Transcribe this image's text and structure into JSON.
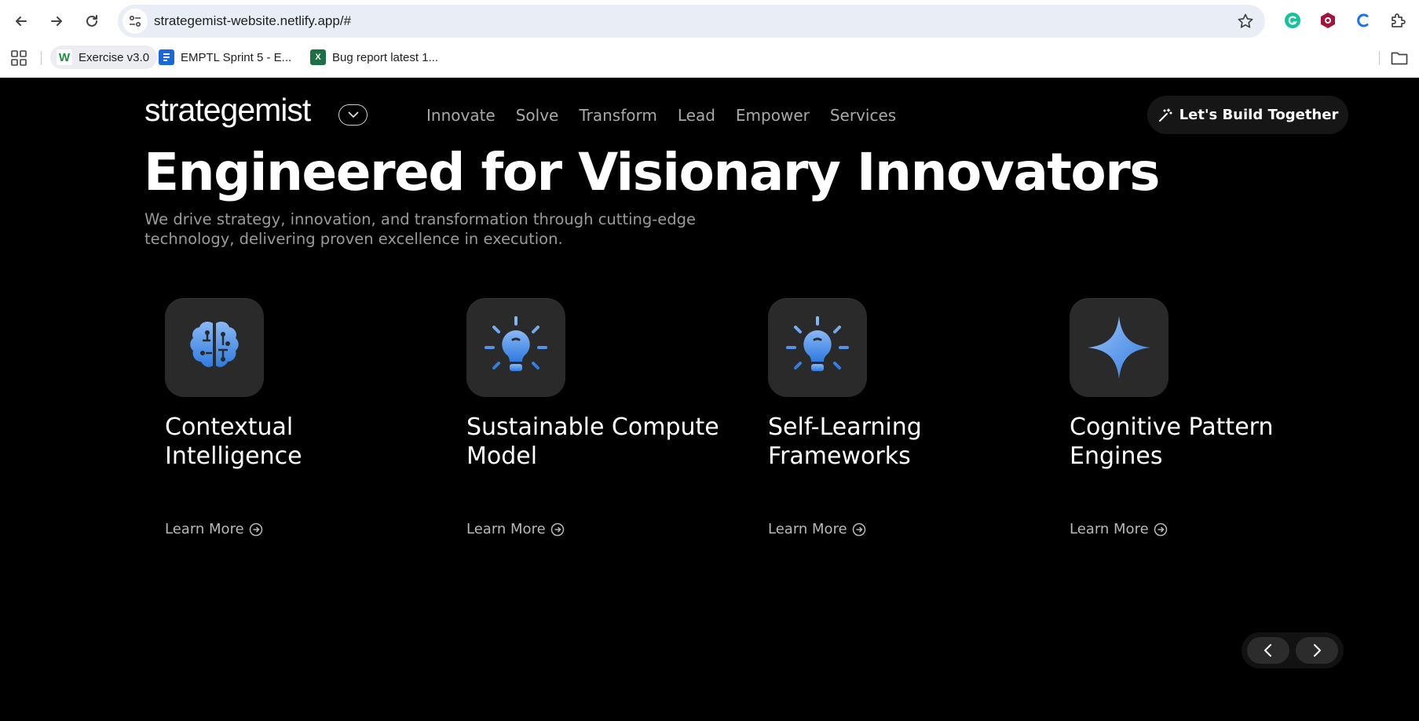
{
  "browser": {
    "url": "strategemist-website.netlify.app/#",
    "bookmarks": [
      {
        "label": "Exercise v3.0",
        "icon": "w-icon"
      },
      {
        "label": "EMPTL Sprint 5 - E...",
        "icon": "jira-icon"
      },
      {
        "label": "Bug report latest 1...",
        "icon": "excel-icon"
      }
    ]
  },
  "site": {
    "logo": "strategemist",
    "nav": [
      "Innovate",
      "Solve",
      "Transform",
      "Lead",
      "Empower",
      "Services"
    ],
    "cta_label": "Let's Build Together",
    "hero": {
      "title": "Engineered for Visionary Innovators",
      "subtitle": "We drive strategy, innovation, and transformation through cutting-edge technology, delivering proven excellence in execution."
    },
    "cards": [
      {
        "title": "Contextual Intelligence",
        "link": "Learn More",
        "icon": "brain-circuit-icon"
      },
      {
        "title": "Sustainable Compute Model",
        "link": "Learn More",
        "icon": "lightbulb-icon"
      },
      {
        "title": "Self-Learning Frameworks",
        "link": "Learn More",
        "icon": "lightbulb-icon"
      },
      {
        "title": "Cognitive Pattern Engines",
        "link": "Learn More",
        "icon": "sparkle-icon"
      }
    ],
    "colors": {
      "background": "#000000",
      "accent": "#4a8fe7",
      "tile": "#2a2a2a"
    }
  }
}
